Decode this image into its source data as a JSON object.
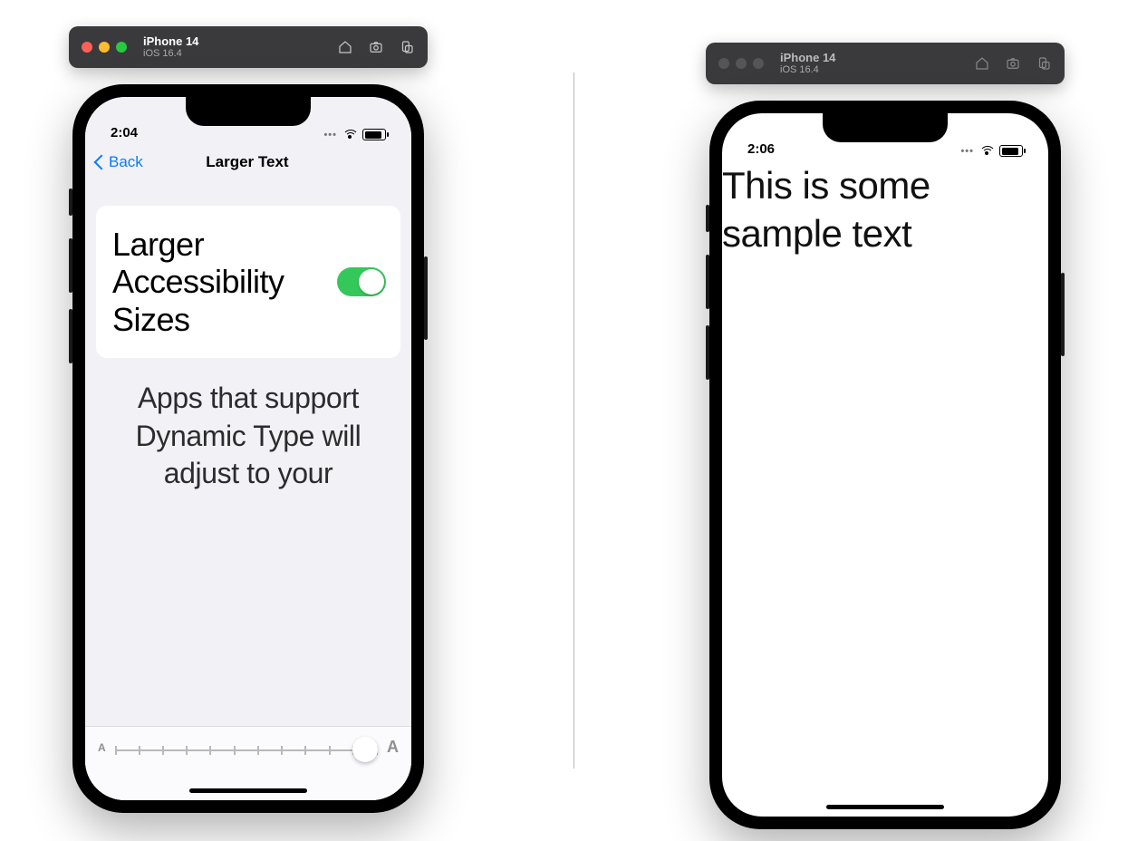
{
  "left_sim": {
    "title": "iPhone 14",
    "subtitle": "iOS 16.4",
    "active": true,
    "time": "2:04"
  },
  "right_sim": {
    "title": "iPhone 14",
    "subtitle": "iOS 16.4",
    "active": false,
    "time": "2:06"
  },
  "settings": {
    "back_label": "Back",
    "nav_title": "Larger Text",
    "toggle_label": "Larger Accessi­bility Sizes",
    "toggle_on": true,
    "footnote": "Apps that support Dynamic Type will adjust to your",
    "slider": {
      "min_glyph": "A",
      "max_glyph": "A",
      "tick_count": 12,
      "thumb_index": 11
    }
  },
  "sample_app": {
    "body_text": "This is some sample text"
  }
}
